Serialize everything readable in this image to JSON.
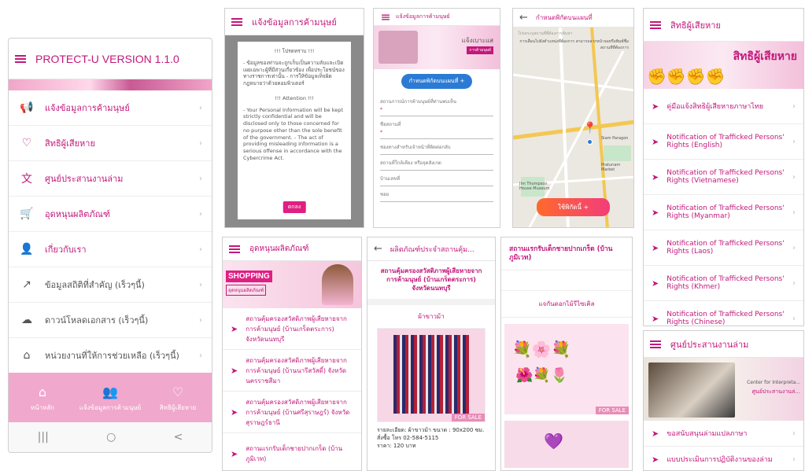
{
  "colors": {
    "primary": "#c2187a",
    "tabbar": "#f0a8cc",
    "cta_blue": "#2b7bd4",
    "button_pink": "#e01f83"
  },
  "main_menu": {
    "title": "PROTECT-U VERSION 1.1.0",
    "items": [
      {
        "label": "แจ้งข้อมูลการค้ามนุษย์",
        "icon": "megaphone-icon"
      },
      {
        "label": "สิทธิผู้เสียหาย",
        "icon": "heart-icon"
      },
      {
        "label": "ศูนย์ประสานงานล่าม",
        "icon": "translate-icon"
      },
      {
        "label": "อุดหนุนผลิตภัณฑ์",
        "icon": "cart-icon"
      },
      {
        "label": "เกี่ยวกับเรา",
        "icon": "person-icon"
      },
      {
        "label": "ข้อมูลสถิติที่สำคัญ (เร็วๆนี้)",
        "icon": "trend-icon"
      },
      {
        "label": "ดาวน์โหลดเอกสาร (เร็วๆนี้)",
        "icon": "cloud-download-icon"
      },
      {
        "label": "หน่วยงานที่ให้การช่วยเหลือ (เร็วๆนี้)",
        "icon": "home-icon"
      }
    ],
    "tabs": [
      {
        "label": "หน้าหลัก",
        "icon": "home-icon"
      },
      {
        "label": "แจ้งข้อมูลการค้ามนุษย์",
        "icon": "people-icon"
      },
      {
        "label": "สิทธิผู้เสียหาย",
        "icon": "heart-icon"
      }
    ],
    "system_nav": [
      "|||",
      "○",
      "<"
    ]
  },
  "notice_screen": {
    "title": "แจ้งข้อมูลการค้ามนุษย์",
    "dialog_title_th": "!!! โปรดทราบ !!!",
    "dialog_text_th": "- ข้อมูลของท่านจะถูกเก็บเป็นความลับและเปิดเผยเฉพาะผู้ที่มีส่วนเกี่ยวข้อง เพื่อประโยชน์ของทางราชการเท่านั้น - การให้ข้อมูลเท็จผิดกฎหมายว่าด้วยคอมพิวเตอร์",
    "dialog_title_en": "!!! Attention !!!",
    "dialog_text_en": "- Your Personal Information will be kept strictly confidential and will be disclosed only to those concerned for no purpose other than the sole benefit of the government. - The act of providing misleading information is a serious offense in accordance with the Cybercrime Act.",
    "ok_label": "ตกลง"
  },
  "report_form": {
    "title": "แจ้งข้อมูลการค้ามนุษย์",
    "banner_text": "แจ้งเบาะแส",
    "banner_sub": "การค้ามนุษย์",
    "locate_button": "กำหนดพิกัดบนแผนที่",
    "fields": [
      "สถานการณ์การค้ามนุษย์ที่ท่านพบเห็น",
      "ชื่อสถานที่",
      "ช่องทางสำหรับเจ้าหน้าที่ติดต่อกลับ",
      "สถานที่ใกล้เคียง หรือจุดสังเกต",
      "บ้านเลขที่",
      "ซอย"
    ]
  },
  "map_screen": {
    "title": "กำหนดพิกัดบนแผนที่",
    "search_placeholder": "โปรดระบุสถานที่ที่ต้องการค้นหา",
    "hint": "การเลื่อนไปยังตำแหน่งที่ต้องการ สามารถลากหน้าจอหรือพิมพ์ชื่อสถานที่ที่ต้องการ",
    "use_button": "ใช้พิกัดนี้",
    "map_labels": [
      "Jim Thompson House Museum",
      "Pratunam Market",
      "Siam Paragon"
    ]
  },
  "rights_screen": {
    "title": "สิทธิผู้เสียหาย",
    "banner_text": "สิทธิผู้เสียหาย",
    "items": [
      "คู่มือแจ้งสิทธิผู้เสียหายภาษาไทย",
      "Notification of Trafficked Persons' Rights (English)",
      "Notification of Trafficked Persons' Rights (Vietnamese)",
      "Notification of Trafficked Persons' Rights (Myanmar)",
      "Notification of Trafficked Persons' Rights (Laos)",
      "Notification of Trafficked Persons' Rights (Khmer)",
      "Notification of Trafficked Persons' Rights (Chinese)"
    ]
  },
  "shop_screen": {
    "title": "อุดหนุนผลิตภัณฑ์",
    "banner_text": "SHOPPING",
    "banner_sub": "อุดหนุนผลิตภัณฑ์",
    "items": [
      "สถานคุ้มครองสวัสดิภาพผู้เสียหายจากการค้ามนุษย์ (บ้านเกร็ดตระการ) จังหวัดนนทบุรี",
      "สถานคุ้มครองสวัสดิภาพผู้เสียหายจากการค้ามนุษย์ (บ้านนารีสวัสดิ์) จังหวัดนครราชสีมา",
      "สถานคุ้มครองสวัสดิภาพผู้เสียหายจากการค้ามนุษย์ (บ้านศรีสุราษฎร์) จังหวัดสุราษฎร์ธานี",
      "สถานแรกรับเด็กชายปากเกร็ด (บ้านภูมิเวท)"
    ]
  },
  "product_screen": {
    "title": "ผลิตภัณฑ์ประจำสถานคุ้ม...",
    "shelter": "สถานคุ้มครองสวัสดิภาพผู้เสียหายจากการค้ามนุษย์ (บ้านเกร็ดตระการ) จังหวัดนนทบุรี",
    "product": "ผ้าขาวม้า",
    "for_sale": "FOR SALE",
    "detail": "รายละเอียด: ผ้าขาวม้า ขนาด : 90x200 ซม. สั่งซื้อ โทร 02-584-5115",
    "price": "ราคา: 120 บาท"
  },
  "flower_screen": {
    "shelter": "สถานแรกรับเด็กชายปากเกร็ด (บ้านภูมิเวท)",
    "product": "แจกันดอกไม้รีไซเคิล",
    "for_sale": "FOR SALE"
  },
  "interpreter_screen": {
    "title": "ศูนย์ประสานงานล่าม",
    "banner_text": "Center for Interpreta...",
    "banner_sub": "ศูนย์ประสานงานล่...",
    "items": [
      "ขอสนับสนุนล่ามแปลภาษา",
      "แบบประเมินการปฏิบัติงานของล่าม"
    ]
  }
}
